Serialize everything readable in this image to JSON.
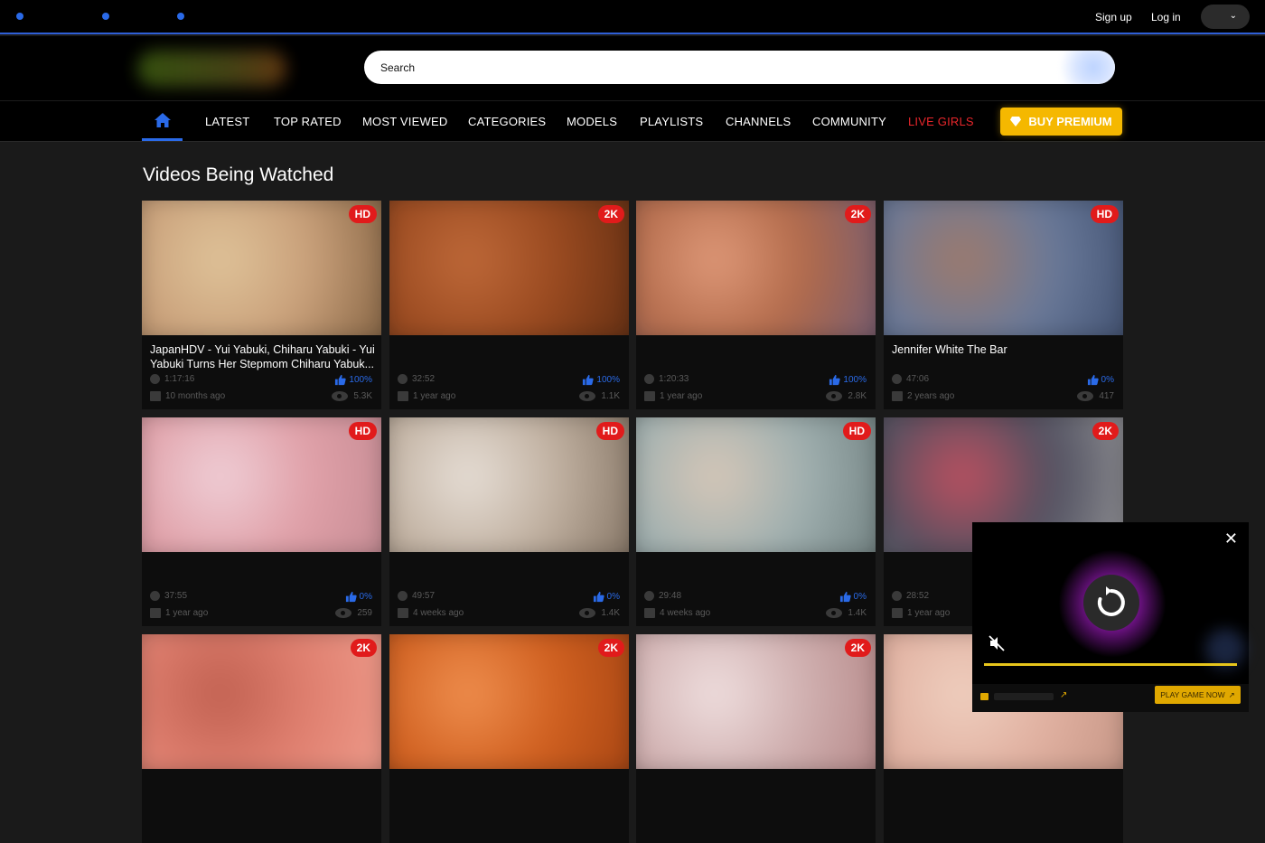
{
  "topbar": {
    "signup_label": "Sign up",
    "login_label": "Log in",
    "accent_color": "#2a6ae8"
  },
  "search": {
    "placeholder": "Search"
  },
  "nav": {
    "items": [
      "LATEST",
      "TOP RATED",
      "MOST VIEWED",
      "CATEGORIES",
      "MODELS",
      "PLAYLISTS",
      "CHANNELS",
      "COMMUNITY"
    ],
    "live_label": "LIVE GIRLS",
    "premium_label": "BUY PREMIUM",
    "premium_color": "#f5b800",
    "live_color": "#e8262b"
  },
  "section": {
    "title": "Videos Being Watched"
  },
  "videos": [
    {
      "badge": "HD",
      "title": "JapanHDV - Yui Yabuki, Chiharu Yabuki - Yui Yabuki Turns Her Stepmom Chiharu Yabuk...",
      "duration": "1:17:16",
      "rating": "100%",
      "age": "10 months ago",
      "views": "5.3K"
    },
    {
      "badge": "2K",
      "title": "",
      "duration": "32:52",
      "rating": "100%",
      "age": "1 year ago",
      "views": "1.1K"
    },
    {
      "badge": "2K",
      "title": "",
      "duration": "1:20:33",
      "rating": "100%",
      "age": "1 year ago",
      "views": "2.8K"
    },
    {
      "badge": "HD",
      "title": "Jennifer White The Bar",
      "duration": "47:06",
      "rating": "0%",
      "age": "2 years ago",
      "views": "417"
    },
    {
      "badge": "HD",
      "title": "",
      "duration": "37:55",
      "rating": "0%",
      "age": "1 year ago",
      "views": "259"
    },
    {
      "badge": "HD",
      "title": "",
      "duration": "49:57",
      "rating": "0%",
      "age": "4 weeks ago",
      "views": "1.4K"
    },
    {
      "badge": "HD",
      "title": "",
      "duration": "29:48",
      "rating": "0%",
      "age": "4 weeks ago",
      "views": "1.4K"
    },
    {
      "badge": "2K",
      "title": "",
      "duration": "28:52",
      "rating": "",
      "age": "1 year ago",
      "views": ""
    },
    {
      "badge": "2K"
    },
    {
      "badge": "2K"
    },
    {
      "badge": "2K"
    },
    {
      "badge": ""
    }
  ],
  "ad": {
    "play_label": "PLAY GAME NOW",
    "accent_color": "#e0a800"
  }
}
